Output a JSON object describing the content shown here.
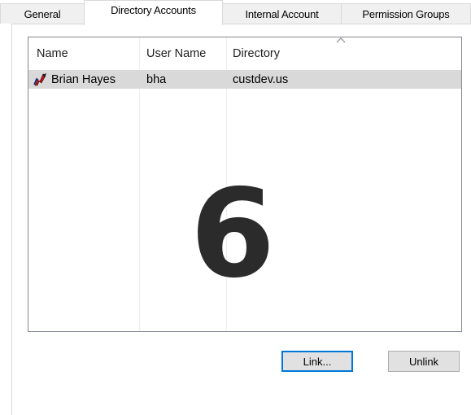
{
  "tabs": [
    {
      "label": "General"
    },
    {
      "label": "Directory Accounts"
    },
    {
      "label": "Internal Account"
    },
    {
      "label": "Permission Groups"
    }
  ],
  "list": {
    "columns": [
      "Name",
      "User Name",
      "Directory"
    ],
    "rows": [
      {
        "name": "Brian Hayes",
        "username": "bha",
        "directory": "custdev.us",
        "icon": "directory-user-icon"
      }
    ]
  },
  "overlay": {
    "watermark": "6"
  },
  "buttons": {
    "link": "Link...",
    "unlink": "Unlink"
  },
  "colors": {
    "selected_row": "#d9d9d9",
    "default_button_border": "#0078d7",
    "watermark": "#2b2b2b"
  }
}
